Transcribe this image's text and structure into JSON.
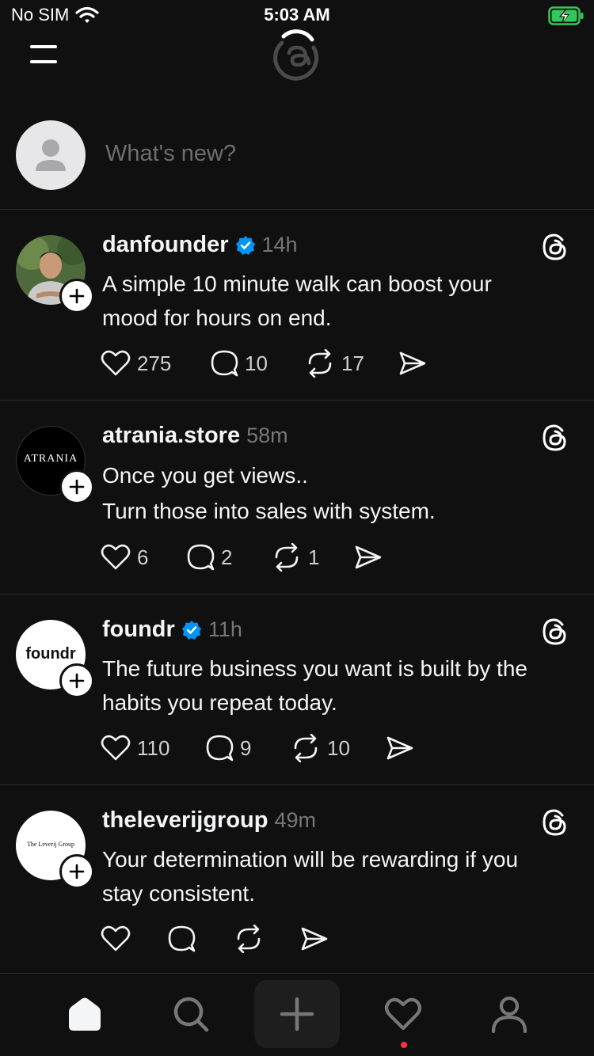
{
  "status_bar": {
    "carrier": "No SIM",
    "time": "5:03 AM"
  },
  "composer": {
    "placeholder": "What's new?"
  },
  "posts": [
    {
      "username": "danfounder",
      "verified": true,
      "time": "14h",
      "lines": [
        "A simple 10 minute walk can boost your",
        "mood for hours on end."
      ],
      "likes": "275",
      "replies": "10",
      "reposts": "17"
    },
    {
      "username": "atrania.store",
      "verified": false,
      "time": "58m",
      "lines": [
        "Once you get views..",
        "Turn those into sales with system."
      ],
      "likes": "6",
      "replies": "2",
      "reposts": "1",
      "avatar_text": "ATRANIA"
    },
    {
      "username": "foundr",
      "verified": true,
      "time": "11h",
      "lines": [
        "The future business you want is built by the",
        "habits you repeat today."
      ],
      "likes": "110",
      "replies": "9",
      "reposts": "10",
      "avatar_text": "foundr"
    },
    {
      "username": "theleverijgroup",
      "verified": false,
      "time": "49m",
      "lines": [
        "Your determination will be rewarding if you",
        "stay consistent."
      ],
      "likes": "",
      "replies": "",
      "reposts": "",
      "avatar_text": "The Leverij Group"
    }
  ],
  "colors": {
    "background": "#101010",
    "verified": "#0095f6",
    "battery": "#34c759",
    "notification": "#ff3040"
  },
  "icons": [
    "wifi-icon",
    "battery-charging-icon",
    "menu-icon",
    "threads-logo-icon",
    "heart-icon",
    "comment-icon",
    "repost-icon",
    "share-icon",
    "home-icon",
    "search-icon",
    "plus-icon",
    "activity-heart-icon",
    "profile-icon"
  ]
}
